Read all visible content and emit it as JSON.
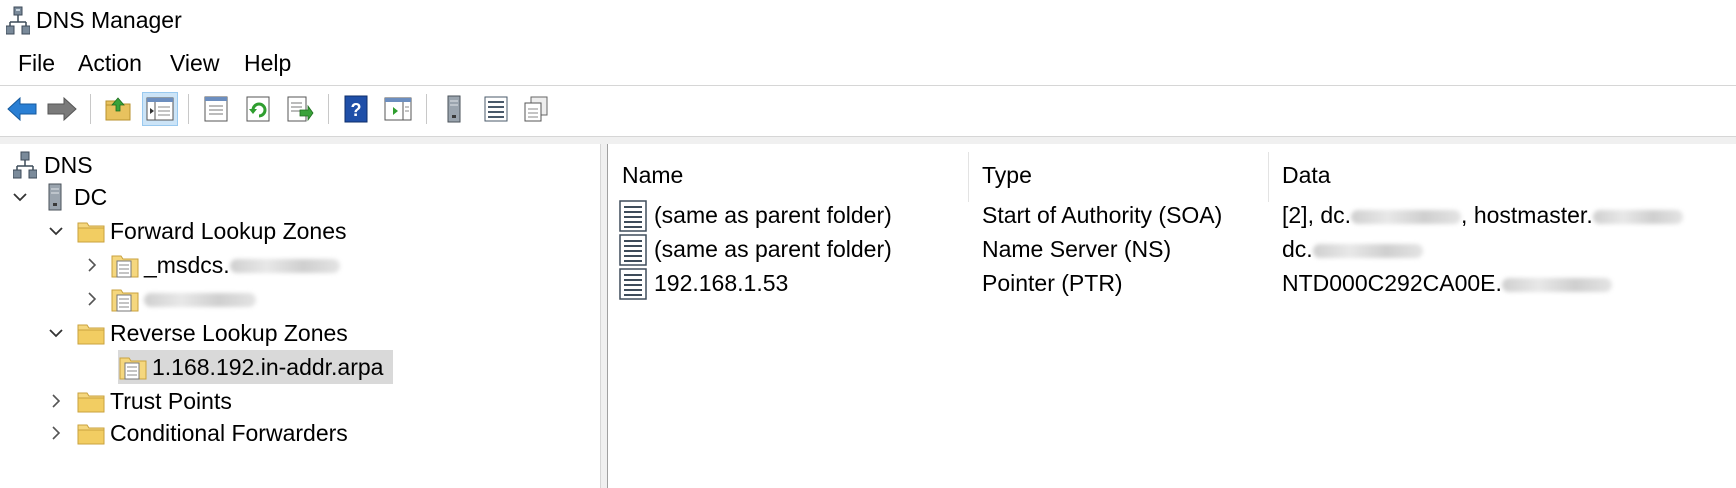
{
  "window": {
    "title": "DNS Manager"
  },
  "menu": {
    "file": "File",
    "action": "Action",
    "view": "View",
    "help": "Help"
  },
  "toolbar": {
    "buttons": [
      "back-arrow-icon",
      "forward-arrow-icon",
      "up-folder-icon",
      "show-hide-console-tree-icon",
      "properties-icon",
      "refresh-icon",
      "export-list-icon",
      "help-icon",
      "action-pane-icon",
      "server-icon",
      "list-view-icon",
      "detail-view-icon"
    ]
  },
  "tree": {
    "root": "DNS",
    "server": "DC",
    "forward_zones": "Forward Lookup Zones",
    "msdcs": "_msdcs.",
    "reverse_zones": "Reverse Lookup Zones",
    "reverse_zone_selected": "1.168.192.in-addr.arpa",
    "trust_points": "Trust Points",
    "conditional_forwarders": "Conditional Forwarders"
  },
  "list": {
    "headers": {
      "name": "Name",
      "type": "Type",
      "data": "Data"
    },
    "rows": [
      {
        "name": "(same as parent folder)",
        "type": "Start of Authority (SOA)",
        "data_a": "[2], dc.",
        "data_b": ", hostmaster."
      },
      {
        "name": "(same as parent folder)",
        "type": "Name Server (NS)",
        "data_a": "dc.",
        "data_b": ""
      },
      {
        "name": "192.168.1.53",
        "type": "Pointer (PTR)",
        "data_a": "NTD000C292CA00E.",
        "data_b": ""
      }
    ]
  },
  "colors": {
    "selection": "#d9d9d9",
    "active_button": "#cce4f7",
    "folder": "#e8c25e"
  }
}
